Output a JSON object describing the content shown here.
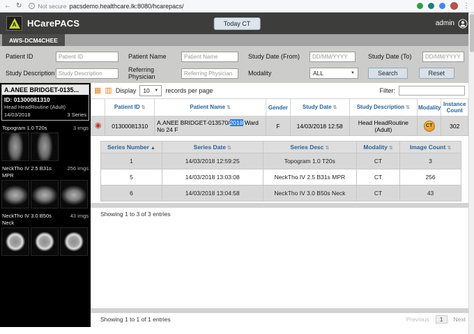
{
  "browser": {
    "security_label": "Not secure",
    "url": "pacsdemo.healthcare.lk:8080/hcarepacs/"
  },
  "header": {
    "app_title": "HCarePACS",
    "today_button": "Today CT",
    "username": "admin"
  },
  "server_tab": "AWS-DCM4CHEE",
  "search": {
    "patient_id_label": "Patient ID",
    "patient_id_placeholder": "Patient ID",
    "patient_name_label": "Patient Name",
    "patient_name_placeholder": "Patient Name",
    "study_date_from_label": "Study Date (From)",
    "study_date_from_placeholder": "DD/MM/YYYY",
    "study_date_to_label": "Study Date (To)",
    "study_date_to_placeholder": "DD/MM/YYYY",
    "study_desc_label": "Study Description",
    "study_desc_placeholder": "Study Description",
    "ref_physician_label": "Referring Physician",
    "ref_physician_placeholder": "Referring Physician",
    "modality_label": "Modality",
    "modality_value": "ALL",
    "search_button": "Search",
    "reset_button": "Reset"
  },
  "sidebar": {
    "patient_name": "A.ANEE BRIDGET-0135...",
    "patient_id": "ID: 01300081310",
    "study_description": "Head HeadRoutine (Adult)",
    "study_date": "14/03/2018",
    "series_count": "3 Series",
    "series_groups": [
      {
        "name": "Topogram 1.0 T20s",
        "count": "3 imgs",
        "thumbs": 2,
        "kind": "scout"
      },
      {
        "name": "NeckTho IV 2.5 B31s MPR",
        "count": "256 imgs",
        "thumbs": 3,
        "kind": "axial"
      },
      {
        "name": "NeckTho IV 3.0 B50s Neck",
        "count": "43 imgs",
        "thumbs": 3,
        "kind": "brain"
      }
    ]
  },
  "toolbar": {
    "display_label": "Display",
    "page_size": "10",
    "records_label": "records per page",
    "filter_label": "Filter:"
  },
  "studies_table": {
    "headers": [
      "Patient ID",
      "Patient Name",
      "Gender",
      "Study Date",
      "Study Description",
      "Modality",
      "Instance Count"
    ],
    "row": {
      "patient_id": "01300081310",
      "name_pre": "A.ANEE BRIDGET-013570/",
      "name_highlight": "2018",
      "name_post": " Ward No 24 F",
      "gender": "F",
      "study_date": "14/03/2018 12:58",
      "study_description": "Head HeadRoutine (Adult)",
      "modality": "CT",
      "instance_count": "302"
    }
  },
  "series_table": {
    "headers": [
      "Series Number",
      "Series Date",
      "Series Desc",
      "Modality",
      "Image Count"
    ],
    "rows": [
      {
        "number": "1",
        "date": "14/03/2018 12:59:25",
        "desc": "Topogram 1.0 T20s",
        "modality": "CT",
        "count": "3"
      },
      {
        "number": "5",
        "date": "14/03/2018 13:03:08",
        "desc": "NeckTho IV 2.5 B31s MPR",
        "modality": "CT",
        "count": "256"
      },
      {
        "number": "6",
        "date": "14/03/2018 13:04:58",
        "desc": "NeckTho IV 3.0 B50s Neck",
        "modality": "CT",
        "count": "43"
      }
    ],
    "showing": "Showing 1 to 3 of 3 entries"
  },
  "footer": {
    "showing": "Showing 1 to 1 of 1 entries",
    "previous": "Previous",
    "page": "1",
    "next": "Next"
  },
  "icons": {
    "back": "←",
    "refresh": "↻",
    "menu": "⋮",
    "caret": "▼",
    "grid": "▦",
    "stack": "▥",
    "sort_both": "⇅",
    "sort_asc": "▲",
    "record": "◉"
  },
  "colors": {
    "header_bg": "#3d3d3c",
    "accent_blue": "#2a6496",
    "record_red": "#bb3a27",
    "highlight_blue": "#2f7bd6",
    "logo_green": "#c6d530",
    "ct_badge": "#e0952f"
  }
}
